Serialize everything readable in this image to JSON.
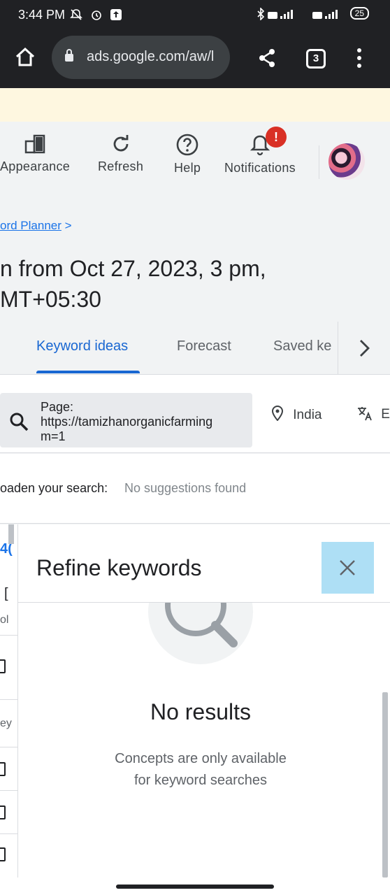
{
  "status_bar": {
    "time": "3:44 PM",
    "left_icons": [
      "mute-bell-icon",
      "alarm-icon",
      "upload-icon"
    ],
    "right_icons": [
      "bluetooth-icon",
      "volte-icon",
      "4g-signal-icon",
      "volte-icon",
      "signal-icon"
    ],
    "battery": "25"
  },
  "browser": {
    "url": "ads.google.com/aw/l",
    "tab_count": "3"
  },
  "toolbar": {
    "items": [
      {
        "label": "Appearance",
        "icon": "appearance-icon"
      },
      {
        "label": "Refresh",
        "icon": "refresh-icon"
      },
      {
        "label": "Help",
        "icon": "help-icon"
      },
      {
        "label": "Notifications",
        "icon": "bell-icon"
      }
    ],
    "notification_badge": "!"
  },
  "breadcrumb": {
    "label": "ord Planner",
    "chevron": ">"
  },
  "page": {
    "title_line1": "n from Oct 27, 2023, 3 pm,",
    "title_line2": "MT+05:30"
  },
  "tabs": [
    {
      "label": "Keyword ideas",
      "active": true
    },
    {
      "label": "Forecast",
      "active": false
    },
    {
      "label": "Saved ke",
      "active": false
    }
  ],
  "search": {
    "line1": "Page:",
    "line2": "https://tamizhanorganicfarming",
    "line3": "m=1",
    "location": "India",
    "language": "En"
  },
  "broaden": {
    "label": "oaden your search:",
    "value": "No suggestions found"
  },
  "left_strip_fragments": [
    "4(",
    "[",
    "ol",
    "ey"
  ],
  "refine_panel": {
    "title": "Refine keywords",
    "empty_title": "No results",
    "empty_line1": "Concepts are only available",
    "empty_line2": "for keyword searches"
  },
  "colors": {
    "accent": "#1967d2",
    "link": "#1a73e8",
    "banner": "#fef7e0",
    "close_highlight": "#aedff5",
    "badge": "#d93025"
  }
}
